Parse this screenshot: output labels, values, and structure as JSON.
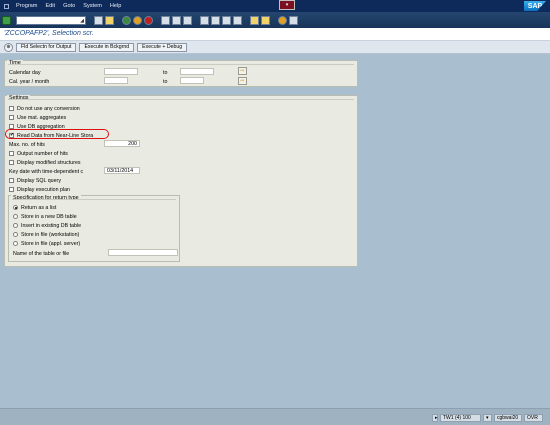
{
  "menu": {
    "items": [
      "Program",
      "Edit",
      "Goto",
      "System",
      "Help"
    ]
  },
  "branding": {
    "logo_text": "SAP"
  },
  "toolbar": {
    "command_placeholder": ""
  },
  "title": "'ZCCOPAFP2', Selection scr.",
  "app_toolbar": {
    "buttons": [
      "Fld Selectn for Output",
      "Execute in Bckgrnd",
      "Execute + Debug"
    ]
  },
  "time_group": {
    "title": "Time",
    "rows": [
      {
        "label": "Calendar day",
        "to_label": "to"
      },
      {
        "label": "Cal. year / month",
        "to_label": "to"
      }
    ]
  },
  "settings_group": {
    "title": "Settings",
    "checkbox_1": {
      "label": "Do not use any conversion",
      "checked": false
    },
    "checkbox_2": {
      "label": "Use mat. aggregates",
      "checked": false
    },
    "checkbox_3": {
      "label": "Use DB aggregation",
      "checked": false
    },
    "checkbox_4": {
      "label": "Read Data from Near-Line Stora",
      "checked": true
    },
    "max_hits": {
      "label": "Max. no. of hits",
      "value": "200"
    },
    "checkbox_5": {
      "label": "Output number of hits",
      "checked": false
    },
    "checkbox_6": {
      "label": "Display modified structures",
      "checked": false
    },
    "key_date": {
      "label": "Key date with time-dependent c",
      "value": "03/11/2014"
    },
    "checkbox_7": {
      "label": "Display SQL query",
      "checked": false
    },
    "checkbox_8": {
      "label": "Display execution plan",
      "checked": false
    }
  },
  "return_group": {
    "title": "Specification for return type",
    "radio_1": {
      "label": "Return as a list",
      "checked": true
    },
    "radio_2": {
      "label": "Store in a new DB table",
      "checked": false
    },
    "radio_3": {
      "label": "Insert in existing DB table",
      "checked": false
    },
    "radio_4": {
      "label": "Store in file (workstation)",
      "checked": false
    },
    "radio_5": {
      "label": "Store in file (appl. server)",
      "checked": false
    },
    "table_name": {
      "label": "Name of the table or file",
      "value": ""
    }
  },
  "status": {
    "system": "TW1 (4) 100",
    "server": "cgbwai20",
    "mode": "OVR"
  },
  "colors": {
    "menubar": "#0e2a5a",
    "background": "#a9bfcf",
    "panel": "#e9ebe2",
    "title": "#1c4b8a",
    "highlight": "#dd1111"
  }
}
